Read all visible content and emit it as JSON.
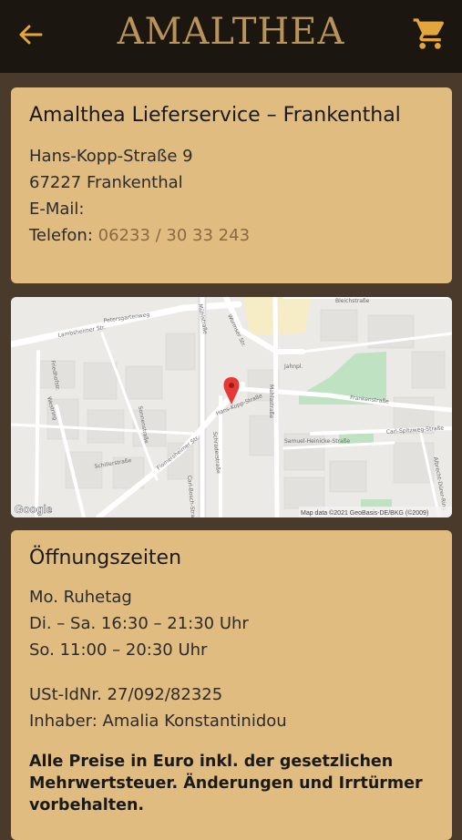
{
  "header": {
    "logo_text": "AMALTHEA",
    "back_icon": "arrow-left-icon",
    "cart_icon": "shopping-cart-icon",
    "accent_color": "#e2a63d"
  },
  "store": {
    "title": "Amalthea Lieferservice – Frankenthal",
    "street": "Hans-Kopp-Straße 9",
    "city": "67227 Frankenthal",
    "email_label": "E-Mail:",
    "phone_label": "Telefon:",
    "phone": "06233 / 30 33 243"
  },
  "map": {
    "streets": [
      "Lambsheimer Str.",
      "Petersgartenweg",
      "Friedhofstr.",
      "Westring",
      "Sonnenstraße",
      "Schillerstraße",
      "Flomersheimer Str.",
      "Wormser Str.",
      "Hans-Kopp-Straße",
      "Mahlastraße",
      "Frankenstraße",
      "Carl-Spitzweg-Straße",
      "Samuel-Heinicke-Straße",
      "Albrecht-Dürer-Ring",
      "Mühlstraße",
      "Jahnpl.",
      "Bleichstraße",
      "Carl-Bosch-Straße",
      "Schraderstraße"
    ],
    "google_label": "Google",
    "attribution": "Map data ©2021 GeoBasis-DE/BKG (©2009)",
    "marker_color": "#e53935"
  },
  "hours": {
    "title": "Öffnungszeiten",
    "lines": [
      "Mo. Ruhetag",
      "Di. – Sa. 16:30 – 21:30 Uhr",
      "So. 11:00 – 20:30 Uhr"
    ],
    "vat": "USt-IdNr. 27/092/82325",
    "owner": "Inhaber: Amalia Konstantinidou",
    "notice": "Alle Preise in Euro inkl. der gesetzlichen Mehrwertsteuer. Änderungen und Irrtürmer vorbehalten."
  }
}
